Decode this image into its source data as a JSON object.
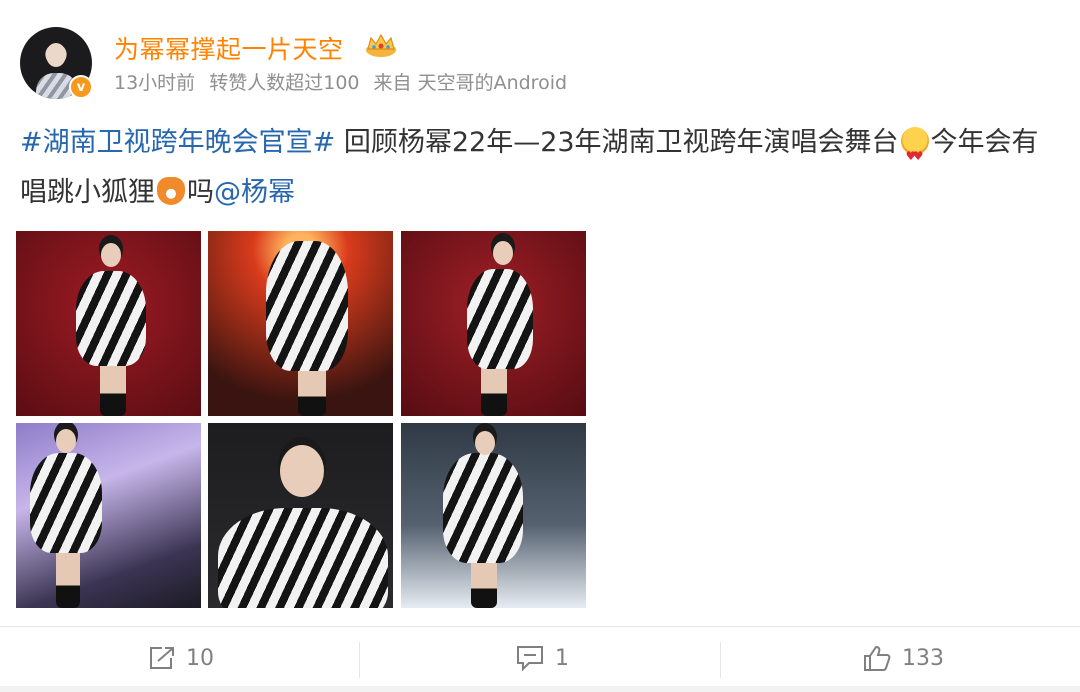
{
  "user": {
    "name": "为幂幂撑起一片天空",
    "verified_badge": "v",
    "crown_icon": "crown-icon"
  },
  "meta": {
    "time": "13小时前",
    "reposts_note": "转赞人数超过100",
    "source": "来自 天空哥的Android"
  },
  "post": {
    "hashtag": "#湖南卫视跨年晚会官宣#",
    "text_part1": " 回顾杨幂22年—23年湖南卫视跨年演唱会舞台",
    "text_part2": "今年会有唱跳小狐狸",
    "text_part3": "吗",
    "mention": "@杨幂",
    "emoji_1": "heart-eyes-emoji",
    "emoji_2": "fox-emoji"
  },
  "photos": [
    {
      "name": "photo-1"
    },
    {
      "name": "photo-2"
    },
    {
      "name": "photo-3"
    },
    {
      "name": "photo-4"
    },
    {
      "name": "photo-5"
    },
    {
      "name": "photo-6"
    }
  ],
  "actions": {
    "repost_count": "10",
    "comment_count": "1",
    "like_count": "133"
  },
  "colors": {
    "username": "#ff8200",
    "link": "#2767ad",
    "meta": "#8f8f8f",
    "action": "#808080"
  }
}
